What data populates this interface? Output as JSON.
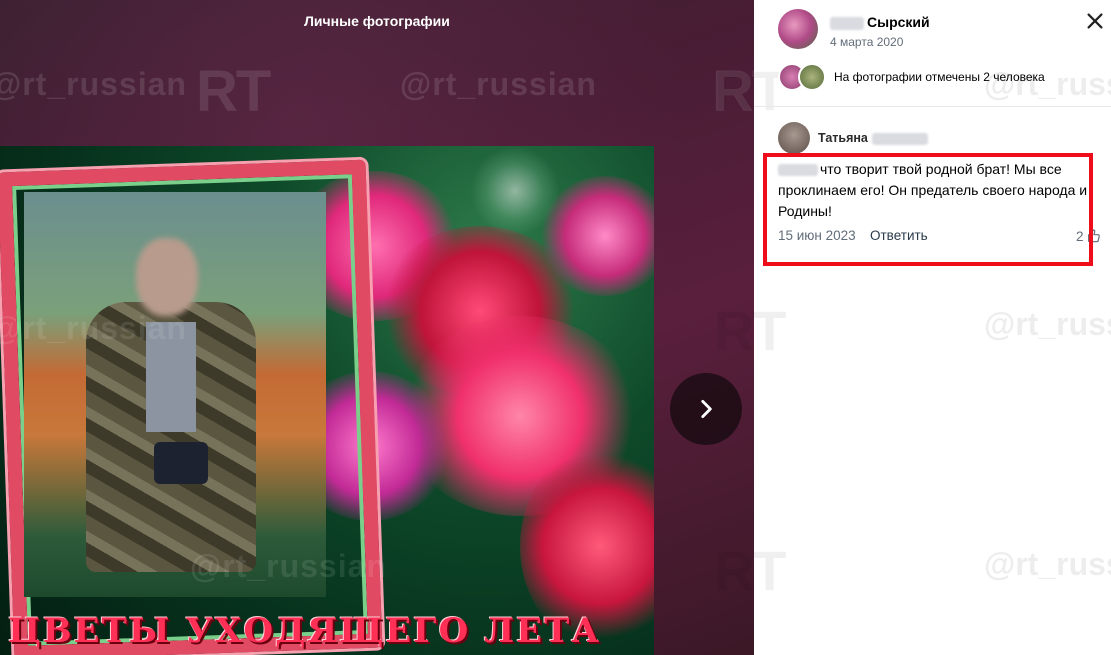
{
  "viewer": {
    "album_title": "Личные фотографии",
    "watermark_handle": "@rt_russian",
    "watermark_logo": "RT",
    "photo_caption": "ЦВЕТЫ УХОДЯЩЕГО ЛЕТА"
  },
  "post": {
    "author_name": "Сырский",
    "date": "4 марта 2020",
    "tagged_text": "На фотографии отмечены 2 человека"
  },
  "comment": {
    "author_name": "Татьяна",
    "text": "что творит твой родной брат! Мы все проклинаем его! Он предатель своего народа и Родины!",
    "date": "15 июн 2023",
    "reply_label": "Ответить",
    "likes": "2"
  },
  "icons": [
    "close-icon",
    "chevron-right-icon",
    "like-icon"
  ],
  "colors": {
    "highlight": "#ef0d19",
    "viewer_bg": "#4a1d35"
  }
}
